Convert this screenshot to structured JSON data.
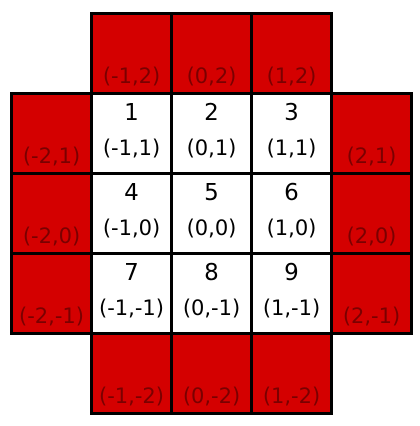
{
  "cells": [
    {
      "id": "top-1",
      "type": "boundary",
      "col": 1,
      "row": 0,
      "number": "",
      "coord": "(-1,2)"
    },
    {
      "id": "top-2",
      "type": "boundary",
      "col": 2,
      "row": 0,
      "number": "",
      "coord": "(0,2)"
    },
    {
      "id": "top-3",
      "type": "boundary",
      "col": 3,
      "row": 0,
      "number": "",
      "coord": "(1,2)"
    },
    {
      "id": "left-1",
      "type": "boundary",
      "col": 0,
      "row": 1,
      "number": "",
      "coord": "(-2,1)"
    },
    {
      "id": "cell-1",
      "type": "interior",
      "col": 1,
      "row": 1,
      "number": "1",
      "coord": "(-1,1)"
    },
    {
      "id": "cell-2",
      "type": "interior",
      "col": 2,
      "row": 1,
      "number": "2",
      "coord": "(0,1)"
    },
    {
      "id": "cell-3",
      "type": "interior",
      "col": 3,
      "row": 1,
      "number": "3",
      "coord": "(1,1)"
    },
    {
      "id": "right-1",
      "type": "boundary",
      "col": 4,
      "row": 1,
      "number": "",
      "coord": "(2,1)"
    },
    {
      "id": "left-2",
      "type": "boundary",
      "col": 0,
      "row": 2,
      "number": "",
      "coord": "(-2,0)"
    },
    {
      "id": "cell-4",
      "type": "interior",
      "col": 1,
      "row": 2,
      "number": "4",
      "coord": "(-1,0)"
    },
    {
      "id": "cell-5",
      "type": "interior",
      "col": 2,
      "row": 2,
      "number": "5",
      "coord": "(0,0)"
    },
    {
      "id": "cell-6",
      "type": "interior",
      "col": 3,
      "row": 2,
      "number": "6",
      "coord": "(1,0)"
    },
    {
      "id": "right-2",
      "type": "boundary",
      "col": 4,
      "row": 2,
      "number": "",
      "coord": "(2,0)"
    },
    {
      "id": "left-3",
      "type": "boundary",
      "col": 0,
      "row": 3,
      "number": "",
      "coord": "(-2,-1)"
    },
    {
      "id": "cell-7",
      "type": "interior",
      "col": 1,
      "row": 3,
      "number": "7",
      "coord": "(-1,-1)"
    },
    {
      "id": "cell-8",
      "type": "interior",
      "col": 2,
      "row": 3,
      "number": "8",
      "coord": "(0,-1)"
    },
    {
      "id": "cell-9",
      "type": "interior",
      "col": 3,
      "row": 3,
      "number": "9",
      "coord": "(1,-1)"
    },
    {
      "id": "right-3",
      "type": "boundary",
      "col": 4,
      "row": 3,
      "number": "",
      "coord": "(2,-1)"
    },
    {
      "id": "bottom-1",
      "type": "boundary",
      "col": 1,
      "row": 4,
      "number": "",
      "coord": "(-1,-2)"
    },
    {
      "id": "bottom-2",
      "type": "boundary",
      "col": 2,
      "row": 4,
      "number": "",
      "coord": "(0,-2)"
    },
    {
      "id": "bottom-3",
      "type": "boundary",
      "col": 3,
      "row": 4,
      "number": "",
      "coord": "(1,-2)"
    }
  ],
  "colors": {
    "boundary_fill": "#d40000",
    "boundary_text": "#7a0000",
    "interior_fill": "#ffffff",
    "interior_text": "#000000",
    "border": "#000000"
  }
}
